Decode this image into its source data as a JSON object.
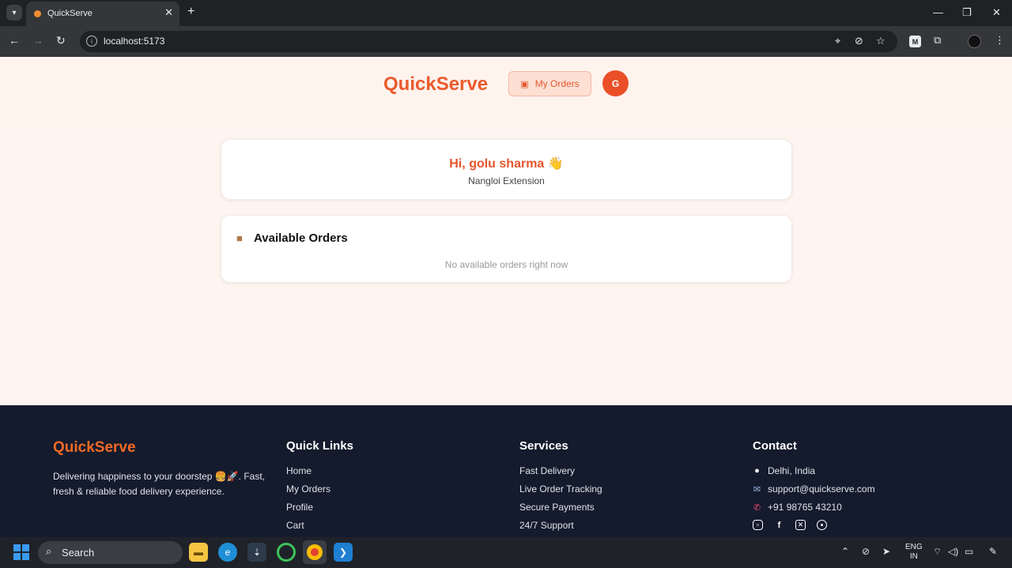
{
  "browser": {
    "tab_title": "QuickServe",
    "url": "localhost:5173",
    "extension_letter": "M"
  },
  "header": {
    "brand": "QuickServe",
    "my_orders_label": "My Orders",
    "avatar_initial": "G"
  },
  "greeting": {
    "text": "Hi, golu sharma 👋",
    "location": "Nangloi Extension"
  },
  "available_orders": {
    "title": "Available Orders",
    "empty_message": "No available orders right now"
  },
  "footer": {
    "brand": "QuickServe",
    "tagline": "Delivering happiness to your doorstep 🍔🚀. Fast, fresh & reliable food delivery experience.",
    "quick_links": {
      "heading": "Quick Links",
      "items": [
        "Home",
        "My Orders",
        "Profile",
        "Cart"
      ]
    },
    "services": {
      "heading": "Services",
      "items": [
        "Fast Delivery",
        "Live Order Tracking",
        "Secure Payments",
        "24/7 Support"
      ]
    },
    "contact": {
      "heading": "Contact",
      "location": "Delhi, India",
      "email": "support@quickserve.com",
      "phone": "+91 98765 43210"
    }
  },
  "taskbar": {
    "search_label": "Search",
    "lang_line1": "ENG",
    "lang_line2": "IN"
  },
  "colors": {
    "brand": "#ea5a2d",
    "footer_bg": "#141b2d",
    "page_bg": "#fff5f0"
  }
}
